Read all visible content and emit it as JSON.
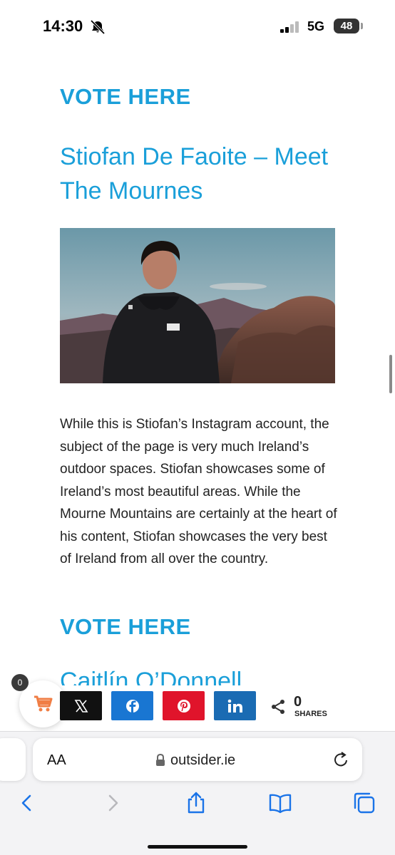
{
  "status_bar": {
    "time": "14:30",
    "network": "5G",
    "battery": "48",
    "icons": [
      "silent-bell-icon",
      "signal-icon",
      "battery-icon"
    ]
  },
  "article": {
    "vote_label_1": "VOTE HERE",
    "title": "Stiofan De Faoite – Meet The Mournes",
    "body": "While this is Stiofan’s Instagram account, the subject of the page is very much Ireland’s outdoor spaces. Stiofan showcases some of Ireland’s most beautiful areas. While the Mourne Mountains are certainly at the heart of his content, Stiofan showcases the very best of Ireland from all over the country.",
    "vote_label_2": "VOTE HERE",
    "next_title_partial": "Caitlín O’Donnell"
  },
  "cart": {
    "count": "0",
    "icon": "cart-icon",
    "color": "#f07e45"
  },
  "share_bar": {
    "buttons": [
      {
        "name": "x",
        "icon": "x-icon",
        "color": "#111111"
      },
      {
        "name": "facebook",
        "icon": "facebook-icon",
        "color": "#1976d2"
      },
      {
        "name": "pinterest",
        "icon": "pinterest-icon",
        "color": "#e0142b"
      },
      {
        "name": "linkedin",
        "icon": "linkedin-icon",
        "color": "#1a6bb3"
      }
    ],
    "count": "0",
    "label": "SHARES"
  },
  "browser": {
    "text_size_label": "AA",
    "url": "outsider.ie",
    "toolbar_icons": [
      "back-icon",
      "forward-icon",
      "share-icon",
      "bookmarks-icon",
      "tabs-icon"
    ]
  },
  "colors": {
    "accent": "#1a9fd9",
    "link_blue": "#1a73e8"
  }
}
